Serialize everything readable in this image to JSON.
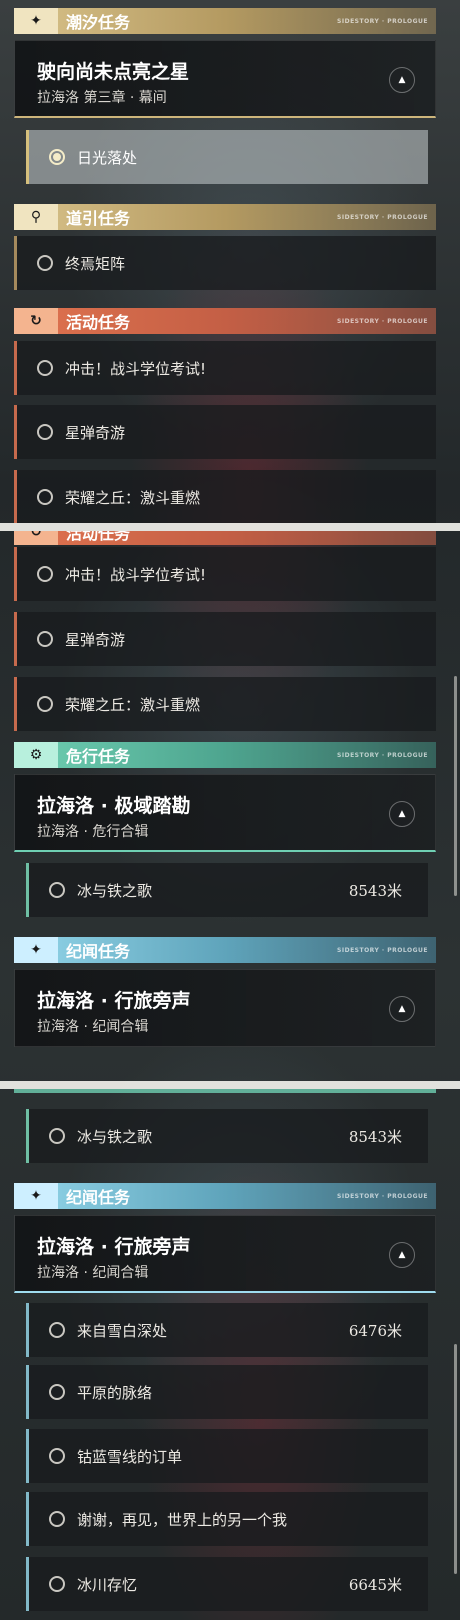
{
  "panel1": {
    "cat_tidal": {
      "label": "潮汐任务",
      "tail": "SIDESTORY · PROLOGUE",
      "icon": "✦"
    },
    "chapter1": {
      "title": "驶向尚未点亮之星",
      "subtitle": "拉海洛 第三章 · 幕间",
      "icon": "▲"
    },
    "quest_sunfall": {
      "label": "日光落处"
    },
    "cat_guide": {
      "label": "道引任务",
      "tail": "SIDESTORY · PROLOGUE",
      "icon": "⚲"
    },
    "quest_matrix": {
      "label": "终焉矩阵"
    },
    "cat_event": {
      "label": "活动任务",
      "tail": "SIDESTORY · PROLOGUE",
      "icon": "↻"
    },
    "event_quests": [
      {
        "label": "冲击！战斗学位考试!"
      },
      {
        "label": "星弹奇游"
      },
      {
        "label": "荣耀之丘：激斗重燃"
      }
    ]
  },
  "panel2": {
    "cat_event_partial": {
      "label": "活动任务"
    },
    "event_quests": [
      {
        "label": "冲击！战斗学位考试!"
      },
      {
        "label": "星弹奇游"
      },
      {
        "label": "荣耀之丘：激斗重燃"
      }
    ],
    "cat_peril": {
      "label": "危行任务",
      "tail": "SIDESTORY · PROLOGUE",
      "icon": "⚙"
    },
    "chapter_peril": {
      "title": "拉海洛 · 极域踏勘",
      "subtitle": "拉海洛 · 危行合辑",
      "icon": "▲"
    },
    "quest_ice": {
      "label": "冰与铁之歌",
      "distance": "8543米"
    },
    "cat_chronicle": {
      "label": "纪闻任务",
      "tail": "SIDESTORY · PROLOGUE",
      "icon": "✦"
    },
    "chapter_chronicle": {
      "title": "拉海洛 · 行旅旁声",
      "subtitle": "拉海洛 · 纪闻合辑",
      "icon": "▲"
    }
  },
  "panel3": {
    "quest_ice": {
      "label": "冰与铁之歌",
      "distance": "8543米"
    },
    "cat_chronicle": {
      "label": "纪闻任务",
      "tail": "SIDESTORY · PROLOGUE",
      "icon": "✦"
    },
    "chapter_chronicle": {
      "title": "拉海洛 · 行旅旁声",
      "subtitle": "拉海洛 · 纪闻合辑",
      "icon": "▲"
    },
    "quests": [
      {
        "label": "来自雪白深处",
        "distance": "6476米"
      },
      {
        "label": "平原的脉络",
        "distance": ""
      },
      {
        "label": "钴蓝雪线的订单",
        "distance": ""
      },
      {
        "label": "谢谢，再见，世界上的另一个我",
        "distance": ""
      },
      {
        "label": "冰川存忆",
        "distance": "6645米"
      }
    ]
  }
}
